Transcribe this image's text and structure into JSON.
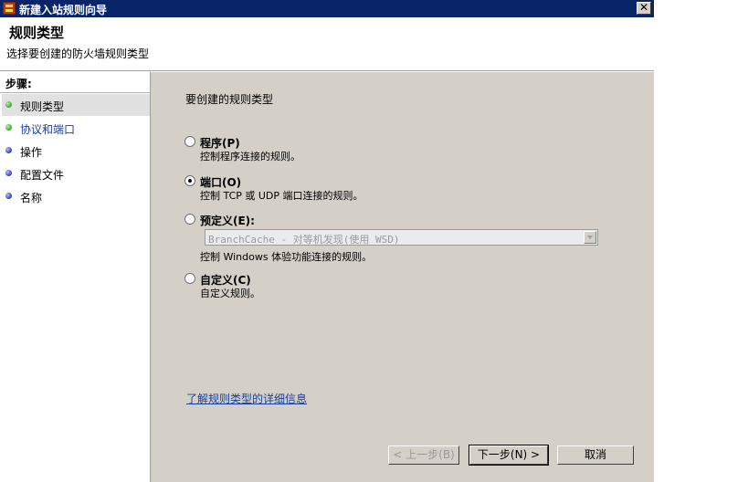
{
  "window": {
    "title": "新建入站规则向导"
  },
  "header": {
    "title": "规则类型",
    "subtitle": "选择要创建的防火墙规则类型"
  },
  "sidebar": {
    "steps_label": "步骤:",
    "items": [
      {
        "label": "规则类型"
      },
      {
        "label": "协议和端口"
      },
      {
        "label": "操作"
      },
      {
        "label": "配置文件"
      },
      {
        "label": "名称"
      }
    ]
  },
  "main": {
    "question": "要创建的规则类型",
    "options": [
      {
        "label": "程序(P)",
        "desc": "控制程序连接的规则。",
        "selected": false
      },
      {
        "label": "端口(O)",
        "desc": "控制 TCP 或 UDP 端口连接的规则。",
        "selected": true
      },
      {
        "label": "预定义(E):",
        "desc": "控制 Windows 体验功能连接的规则。",
        "selected": false
      },
      {
        "label": "自定义(C)",
        "desc": "自定义规则。",
        "selected": false
      }
    ],
    "predefined_value": "BranchCache - 对等机发现(使用 WSD)",
    "learn_more": "了解规则类型的详细信息"
  },
  "buttons": {
    "back": "< 上一步(B)",
    "next": "下一步(N) >",
    "cancel": "取消"
  },
  "icons": {
    "app": "firewall-icon",
    "close": "close-icon",
    "dropdown": "chevron-down-icon"
  },
  "colors": {
    "titlebar": "#0a246a",
    "dialog_bg": "#d4d0c8",
    "link": "#1a3f9a",
    "active_step": "#e1e1e1"
  }
}
